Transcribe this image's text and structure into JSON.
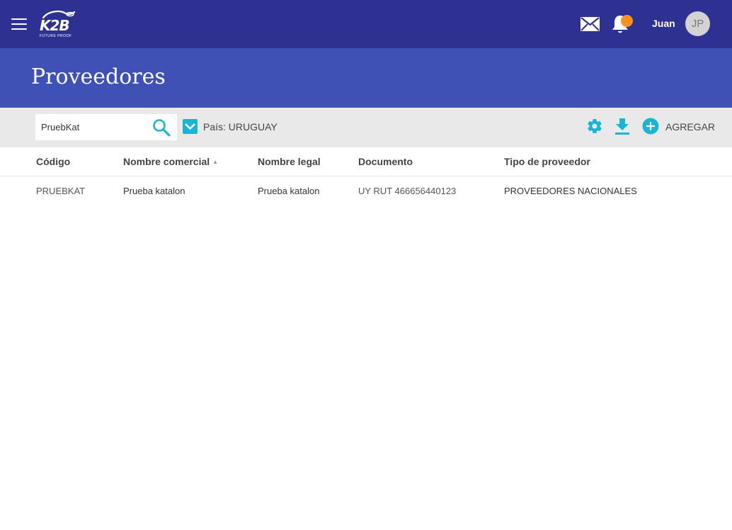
{
  "app": {
    "logo_text": "K2B",
    "logo_tagline": "FUTURE PROOF",
    "user_name": "Juan",
    "avatar_initials": "JP",
    "notification_color": "#f7931e"
  },
  "colors": {
    "topbar": "#2e3192",
    "header_band": "#3f51b5",
    "accent": "#17b5d6",
    "toolbar_bg": "#e9e9e9"
  },
  "page": {
    "title": "Proveedores"
  },
  "toolbar": {
    "search_value": "PruebKat",
    "filter_label": "País: URUGUAY",
    "filter_checked": true,
    "add_label": "AGREGAR",
    "icons": [
      "search-icon",
      "gear-icon",
      "download-icon",
      "add-circle-icon"
    ]
  },
  "table": {
    "columns": [
      "Código",
      "Nombre comercial",
      "Nombre legal",
      "Documento",
      "Tipo de proveedor"
    ],
    "sorted_column": "Nombre comercial",
    "sort_direction": "ascending",
    "rows": [
      {
        "codigo": "PRUEBKAT",
        "nombre_comercial": "Prueba katalon",
        "nombre_legal": "Prueba katalon",
        "documento": "UY RUT 466656440123",
        "tipo": "PROVEEDORES NACIONALES"
      }
    ]
  }
}
